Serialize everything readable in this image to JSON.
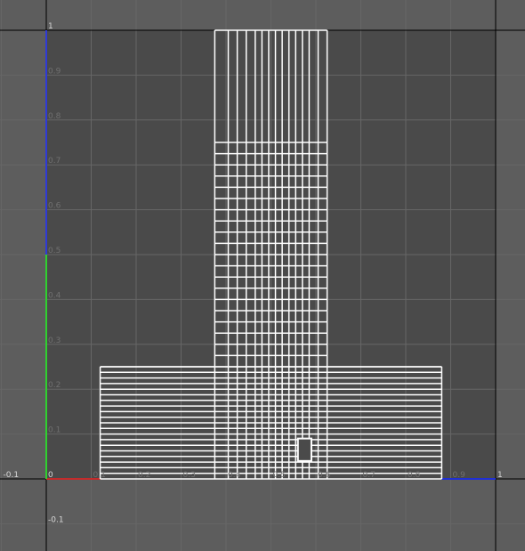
{
  "editor": {
    "name": "UV editor",
    "background_color": "#5d5d5d",
    "uv_region_color": "#4a4a4a",
    "grid_minor_color": "#666666",
    "grid_major_color": "#000000",
    "mesh_color": "#ffffff",
    "axis_colors": {
      "u_positive": "#c42b2b",
      "u_negative": "#1f2fd6",
      "v_lower": "#2fd02f",
      "v_upper": "#2f3ad6"
    },
    "uv_range": {
      "u": [
        -0.1,
        1.0
      ],
      "v": [
        -0.1,
        1.0
      ]
    },
    "minor_step": 0.1,
    "selection": {
      "description": "small selected rectangle",
      "u": [
        0.56,
        0.59
      ],
      "v": [
        0.04,
        0.09
      ]
    }
  },
  "labels": {
    "u_axis": [
      "-0.1",
      "0",
      "0.1",
      "0.2",
      "0.3",
      "0.4",
      "0.5",
      "0.6",
      "0.7",
      "0.8",
      "0.9",
      "1"
    ],
    "v_axis": [
      "-0.1",
      "0.1",
      "0.2",
      "0.3",
      "0.4",
      "0.5",
      "0.6",
      "0.7",
      "0.8",
      "0.9",
      "1"
    ]
  }
}
